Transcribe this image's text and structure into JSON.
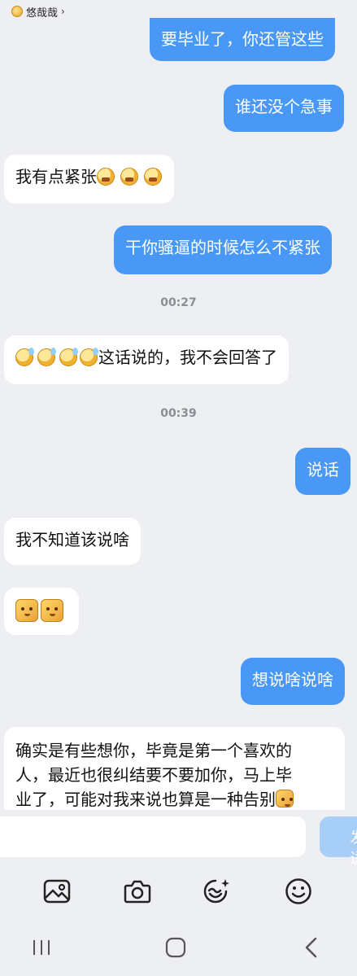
{
  "header": {
    "contact_name": "悠哉哉",
    "chevron": "›"
  },
  "messages": {
    "m1": "要毕业了，你还管这些",
    "m2": "谁还没个急事",
    "m3": "我有点紧张",
    "m4": "干你骚逼的时候怎么不紧张",
    "t1": "00:27",
    "m5": "这话说的，我不会回答了",
    "t2": "00:39",
    "m6": "说话",
    "m7": "我不知道该说啥",
    "m9": "想说啥说啥",
    "m10_line1": "确实是有些想你，毕竟是第一个喜欢的",
    "m10_line2": "人，最近也很纠结要不要加你，马上毕",
    "m10_line3": "业了，可能对我来说也算是一种告别"
  },
  "composer": {
    "send_label": "发送"
  },
  "toolbar": {
    "icons": [
      "image-icon",
      "camera-icon",
      "sticker-icon",
      "emoji-icon"
    ]
  },
  "colors": {
    "sent_bubble": "#4a98f5",
    "received_bubble": "#ffffff",
    "background": "#eeeff3"
  }
}
